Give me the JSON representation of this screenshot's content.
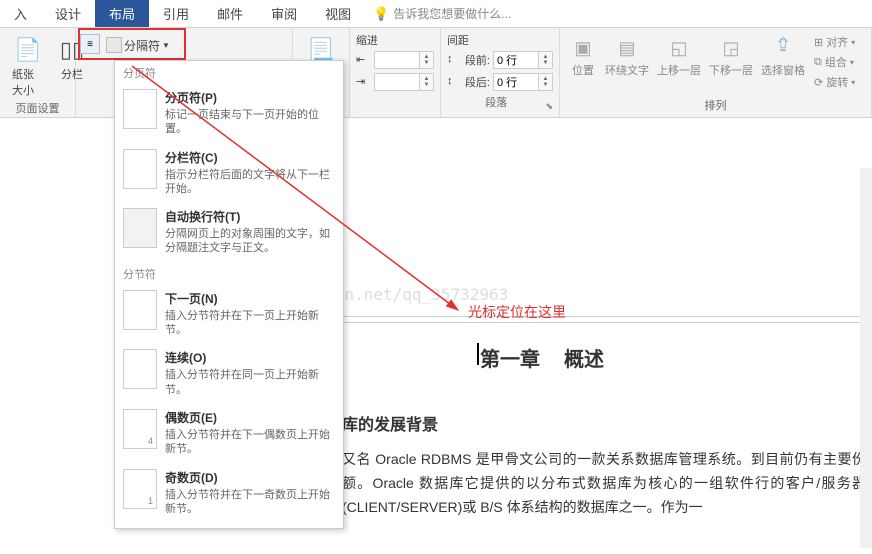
{
  "tabs": {
    "insert": "入",
    "design": "设计",
    "layout": "布局",
    "references": "引用",
    "mailings": "邮件",
    "review": "审阅",
    "view": "视图",
    "tellme": "告诉我您想要做什么..."
  },
  "ribbon": {
    "paper_size": "纸张大小",
    "columns": "分栏",
    "breaks": "分隔符",
    "page_setup_label": "页面设置",
    "indent_label": "缩进",
    "spacing_label": "间距",
    "before_label": "段前:",
    "after_label": "段后:",
    "before_val": "0 行",
    "after_val": "0 行",
    "paragraph_label": "段落",
    "position": "位置",
    "wrap_text": "环绕文字",
    "bring_forward": "上移一层",
    "send_backward": "下移一层",
    "selection_pane": "选择窗格",
    "align": "对齐",
    "group": "组合",
    "rotate": "旋转",
    "arrange_label": "排列"
  },
  "menu": {
    "section1": "分页符",
    "page_break_title": "分页符(P)",
    "page_break_desc": "标记一页结束与下一页开始的位置。",
    "column_break_title": "分栏符(C)",
    "column_break_desc": "指示分栏符后面的文字将从下一栏开始。",
    "text_wrap_title": "自动换行符(T)",
    "text_wrap_desc": "分隔网页上的对象周围的文字，如分隔题注文字与正文。",
    "section2": "分节符",
    "next_page_title": "下一页(N)",
    "next_page_desc": "插入分节符并在下一页上开始新节。",
    "continuous_title": "连续(O)",
    "continuous_desc": "插入分节符并在同一页上开始新节。",
    "even_page_title": "偶数页(E)",
    "even_page_desc": "插入分节符并在下一偶数页上开始新节。",
    "odd_page_title": "奇数页(D)",
    "odd_page_desc": "插入分节符并在下一奇数页上开始新节。"
  },
  "doc": {
    "chapter": "第一章",
    "chapter_sub": "概述",
    "heading2": "库的发展背景",
    "body": "又名 Oracle RDBMS 是甲骨文公司的一款关系数据库管理系统。到目前仍有主要份额。Oracle 数据库它提供的以分布式数据库为核心的一组软件行的客户/服务器(CLIENT/SERVER)或 B/S 体系结构的数据库之一。作为一"
  },
  "annotation": "光标定位在这里",
  "watermark": "http://blog.csdn.net/qq_35732963"
}
